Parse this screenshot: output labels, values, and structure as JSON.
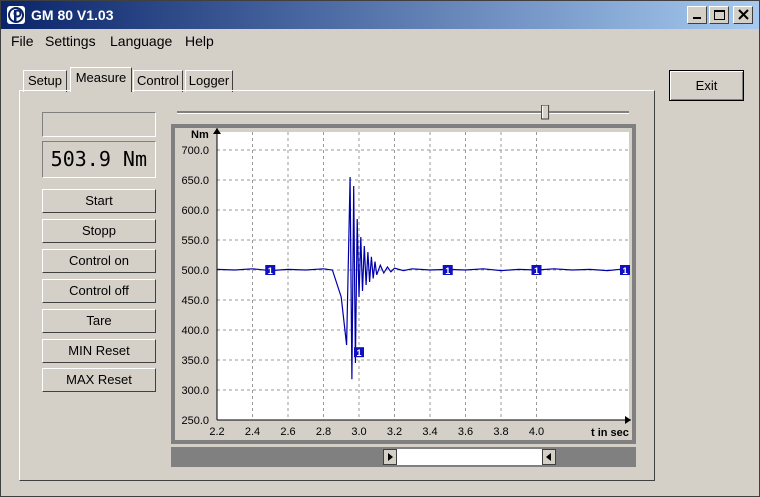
{
  "window": {
    "title": "GM 80 V1.03",
    "icon": "app-logo-icon"
  },
  "menu": [
    {
      "label": "File"
    },
    {
      "label": "Settings"
    },
    {
      "label": "Language"
    },
    {
      "label": "Help"
    }
  ],
  "tabs": [
    {
      "label": "Setup"
    },
    {
      "label": "Measure"
    },
    {
      "label": "Control"
    },
    {
      "label": "Logger"
    }
  ],
  "active_tab": "Measure",
  "display": {
    "status_text": "",
    "value": "503.9 Nm"
  },
  "buttons": {
    "start": "Start",
    "stopp": "Stopp",
    "control_on": "Control on",
    "control_off": "Control off",
    "tare": "Tare",
    "min_reset": "MIN Reset",
    "max_reset": "MAX Reset",
    "exit": "Exit"
  },
  "zoom_slider": {
    "value_fraction": 0.8
  },
  "chart_data": {
    "type": "line",
    "xlabel": "t in sec",
    "ylabel": "Nm",
    "xlim": [
      2.2,
      4.5
    ],
    "ylim": [
      250.0,
      700.0
    ],
    "x_ticks": [
      "2.2",
      "2.4",
      "2.6",
      "2.8",
      "3.0",
      "3.2",
      "3.4",
      "3.6",
      "3.8",
      "4.0"
    ],
    "y_ticks": [
      "250.0",
      "300.0",
      "350.0",
      "400.0",
      "450.0",
      "500.0",
      "550.0",
      "600.0",
      "650.0",
      "700.0"
    ],
    "grid": true,
    "line_color": "#0000aa",
    "series": [
      {
        "x": [
          2.2,
          2.3,
          2.4,
          2.5,
          2.6,
          2.7,
          2.8,
          2.85,
          2.9,
          2.93,
          2.95,
          2.96,
          2.97,
          2.98,
          2.99,
          3.0,
          3.01,
          3.02,
          3.03,
          3.04,
          3.05,
          3.06,
          3.07,
          3.08,
          3.09,
          3.1,
          3.12,
          3.14,
          3.16,
          3.18,
          3.2,
          3.25,
          3.3,
          3.4,
          3.5,
          3.6,
          3.7,
          3.8,
          3.9,
          4.0,
          4.1,
          4.2,
          4.3,
          4.4,
          4.5
        ],
        "y": [
          501,
          500,
          502,
          499,
          501,
          500,
          502,
          500,
          455,
          375,
          655,
          318,
          640,
          345,
          585,
          455,
          555,
          465,
          540,
          475,
          530,
          480,
          522,
          486,
          514,
          492,
          508,
          495,
          505,
          497,
          503,
          499,
          502,
          500,
          501,
          500,
          502,
          499,
          501,
          500,
          502,
          500,
          501,
          499,
          502
        ]
      }
    ],
    "markers": [
      {
        "x": 2.5,
        "y": 500,
        "label": "1"
      },
      {
        "x": 3.0,
        "y": 363,
        "label": "1"
      },
      {
        "x": 3.5,
        "y": 500,
        "label": "1"
      },
      {
        "x": 4.0,
        "y": 500,
        "label": "1"
      },
      {
        "x": 4.5,
        "y": 500,
        "label": "1"
      }
    ]
  },
  "hscroll": {
    "value_fraction": 0.5
  }
}
